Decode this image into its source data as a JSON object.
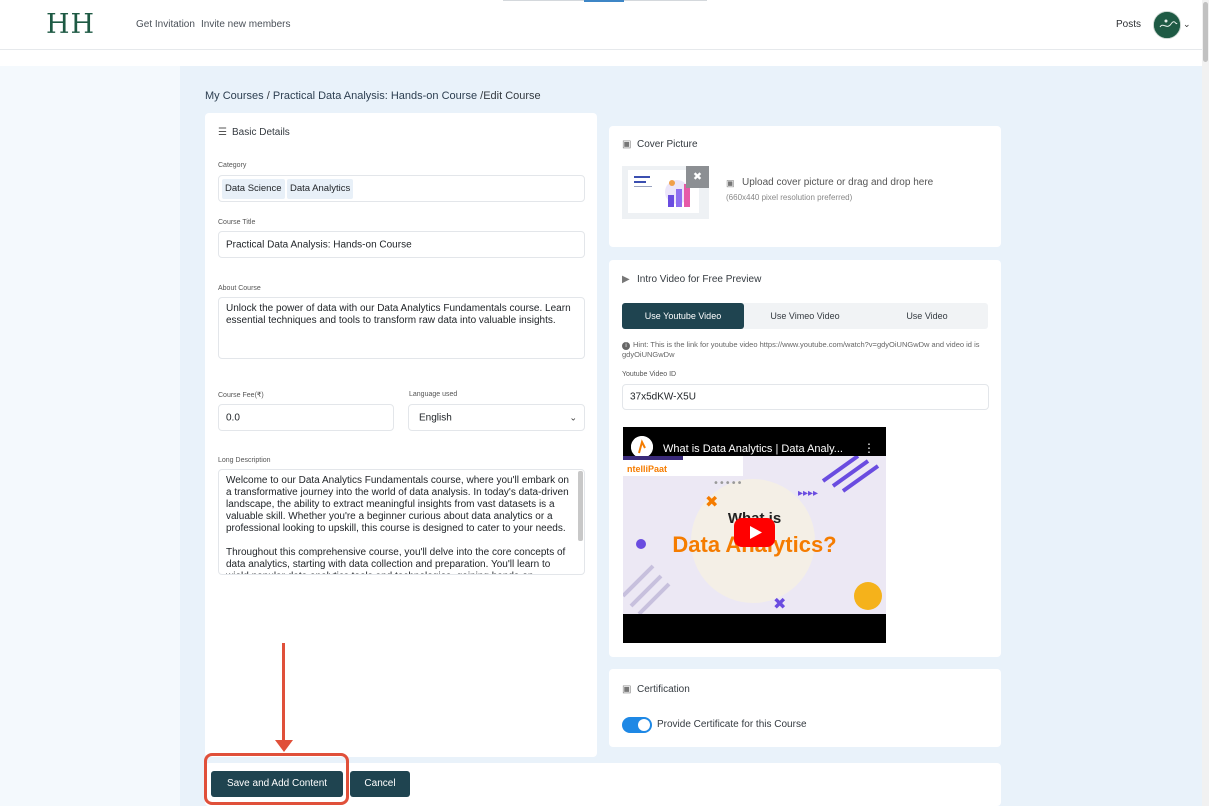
{
  "header": {
    "logo": "HH",
    "nav": [
      "Get Invitation",
      "Invite new members"
    ],
    "posts": "Posts"
  },
  "breadcrumb": {
    "my_courses": "My Courses",
    "sep1": " / ",
    "course": "Practical Data Analysis: Hands-on Course",
    "sep2": " /",
    "current": "Edit Course"
  },
  "basic": {
    "title": "Basic Details",
    "category_label": "Category",
    "categories": [
      "Data Science",
      "Data Analytics"
    ],
    "course_title_label": "Course Title",
    "course_title": "Practical Data Analysis: Hands-on Course",
    "about_label": "About Course",
    "about": "Unlock the power of data with our Data Analytics Fundamentals course. Learn essential techniques and tools to transform raw data into valuable insights.",
    "fee_label": "Course Fee(₹)",
    "fee": "0.0",
    "language_label": "Language used",
    "language": "English",
    "long_desc_label": "Long Description",
    "long_desc_p1": "Welcome to our Data Analytics Fundamentals course, where you'll embark on a transformative journey into the world of data analysis. In today's data-driven landscape, the ability to extract meaningful insights from vast datasets is a valuable skill. Whether you're a beginner curious about data analytics or a professional looking to upskill, this course is designed to cater to your needs.",
    "long_desc_p2": "Throughout this comprehensive course, you'll delve into the core concepts of data analytics, starting with data collection and preparation. You'll learn to wield popular data analytics tools and technologies, gaining hands-on"
  },
  "cover": {
    "title": "Cover Picture",
    "upload_text": "Upload cover picture or drag and drop here",
    "upload_sub": "(660x440 pixel resolution preferred)",
    "remove_icon": "✖"
  },
  "intro": {
    "title": "Intro Video for Free Preview",
    "tabs": [
      "Use Youtube Video",
      "Use Vimeo Video",
      "Use Video"
    ],
    "hint": "Hint: This is the link for youtube video https://www.youtube.com/watch?v=gdyOiUNGwDw and video id is gdyOiUNGwDw",
    "video_id_label": "Youtube Video ID",
    "video_id": "37x5dKW-X5U",
    "video_title": "What is Data Analytics | Data Analy...",
    "brand": "ntelliPaat",
    "thumb_line1": "What is",
    "thumb_line2": "Data Analytics?"
  },
  "certification": {
    "title": "Certification",
    "toggle_label": "Provide Certificate for this Course",
    "enabled": true
  },
  "actions": {
    "save": "Save and Add Content",
    "cancel": "Cancel"
  },
  "colors": {
    "primary": "#1f4450",
    "brand_green": "#1e5a44",
    "toggle_on": "#1e88e5",
    "annotation": "#e0503a"
  }
}
